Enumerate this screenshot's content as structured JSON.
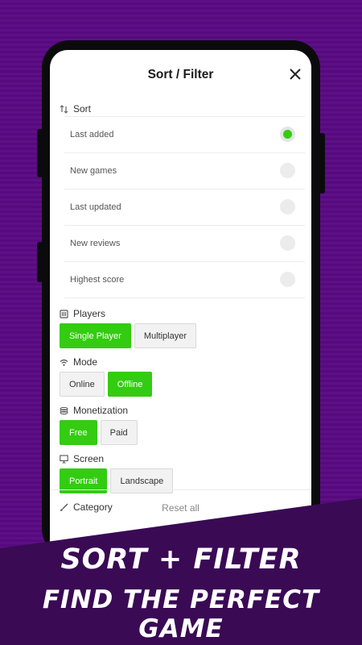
{
  "modal": {
    "title": "Sort / Filter",
    "close_icon": "close-icon"
  },
  "sort": {
    "label": "Sort",
    "options": [
      {
        "label": "Last added",
        "selected": true
      },
      {
        "label": "New games",
        "selected": false
      },
      {
        "label": "Last updated",
        "selected": false
      },
      {
        "label": "New reviews",
        "selected": false
      },
      {
        "label": "Highest score",
        "selected": false
      }
    ]
  },
  "players": {
    "label": "Players",
    "options": [
      {
        "label": "Single Player",
        "selected": true
      },
      {
        "label": "Multiplayer",
        "selected": false
      }
    ]
  },
  "mode": {
    "label": "Mode",
    "options": [
      {
        "label": "Online",
        "selected": false
      },
      {
        "label": "Offline",
        "selected": true
      }
    ]
  },
  "monetization": {
    "label": "Monetization",
    "options": [
      {
        "label": "Free",
        "selected": true
      },
      {
        "label": "Paid",
        "selected": false
      }
    ]
  },
  "screen": {
    "label": "Screen",
    "options": [
      {
        "label": "Portrait",
        "selected": true
      },
      {
        "label": "Landscape",
        "selected": false
      }
    ]
  },
  "category": {
    "label": "Category"
  },
  "footer": {
    "reset_label": "Reset all"
  },
  "banner": {
    "line1": "SORT + FILTER",
    "line2": "FIND THE PERFECT GAME"
  },
  "colors": {
    "accent": "#33cc11",
    "background": "#5e0f86",
    "banner": "#3a0a55"
  }
}
